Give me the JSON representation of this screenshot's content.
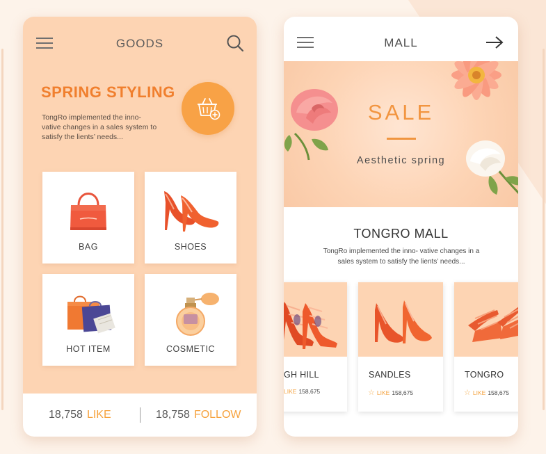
{
  "colors": {
    "accent_orange": "#f07f2e",
    "soft_orange": "#f8a246",
    "peach": "#fdd4b3",
    "text_dark": "#3f3f3f"
  },
  "goods_screen": {
    "menu_icon": "hamburger-menu-icon",
    "title": "GOODS",
    "search_icon": "search-icon",
    "promo": {
      "title": "SPRING STYLING",
      "description": "TongRo implemented the inno-vative changes in a sales system to satisfy the lients’ needs...",
      "basket_icon": "basket-add-icon"
    },
    "categories": [
      {
        "label": "BAG",
        "icon": "bag-icon"
      },
      {
        "label": "SHOES",
        "icon": "shoes-icon"
      },
      {
        "label": "HOT ITEM",
        "icon": "gift-bags-icon"
      },
      {
        "label": "COSMETIC",
        "icon": "perfume-icon"
      }
    ],
    "footer": {
      "likes_count": "18,758",
      "likes_label": "LIKE",
      "follow_count": "18,758",
      "follow_label": "FOLLOW"
    }
  },
  "mall_screen": {
    "menu_icon": "hamburger-menu-icon",
    "title": "MALL",
    "arrow_icon": "arrow-right-icon",
    "banner": {
      "title": "SALE",
      "subtitle": "Aesthetic spring"
    },
    "section_title": "TONGRO MALL",
    "section_description": "TongRo implemented the inno- vative changes in a sales system to satisfy the lients’ needs...",
    "products": [
      {
        "name": "GH HILL",
        "like_label": "LIKE",
        "likes": "158,675"
      },
      {
        "name": "SANDLES",
        "like_label": "LIKE",
        "likes": "158,675"
      },
      {
        "name": "TONGRO",
        "like_label": "LIKE",
        "likes": "158,675"
      }
    ]
  }
}
